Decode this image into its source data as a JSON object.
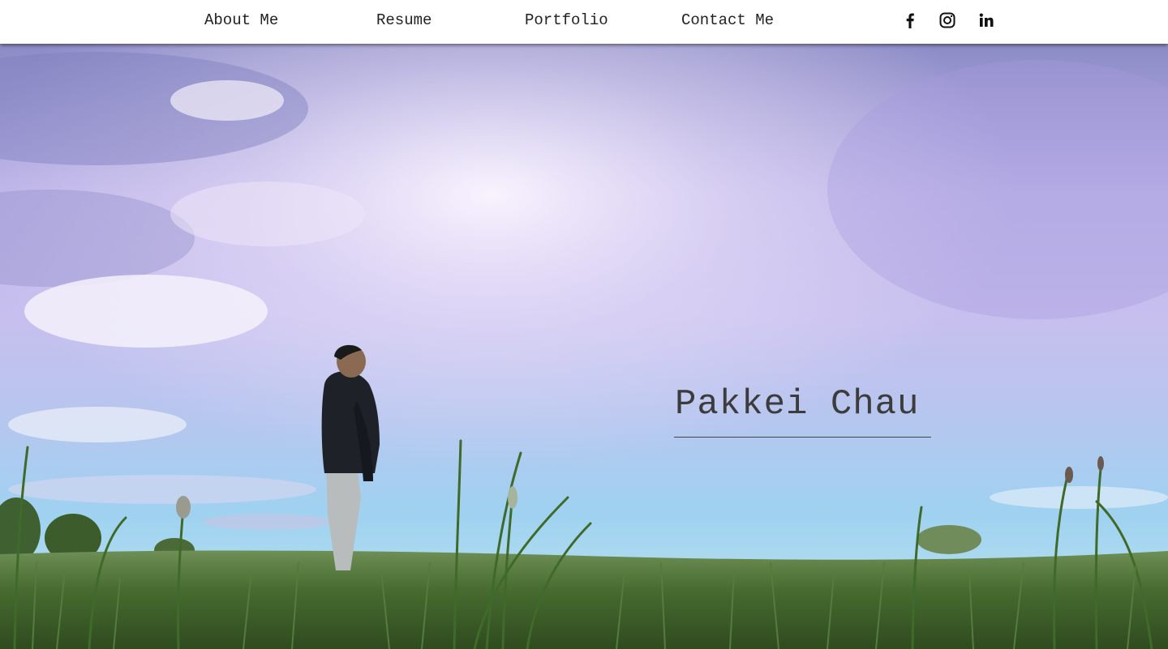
{
  "nav": {
    "items": [
      {
        "label": "About Me"
      },
      {
        "label": "Resume"
      },
      {
        "label": "Portfolio"
      },
      {
        "label": "Contact Me"
      }
    ]
  },
  "social": {
    "icons": [
      "facebook-icon",
      "instagram-icon",
      "linkedin-icon"
    ]
  },
  "hero": {
    "name": "Pakkei Chau",
    "image": "person-standing-in-grass-field-under-purple-sky"
  },
  "colors": {
    "header_bg": "#ffffff",
    "nav_text": "#222222",
    "name_text": "#3c3c3c",
    "sky_purple": "#b9b3e6",
    "grass_green": "#3f5f2a"
  }
}
